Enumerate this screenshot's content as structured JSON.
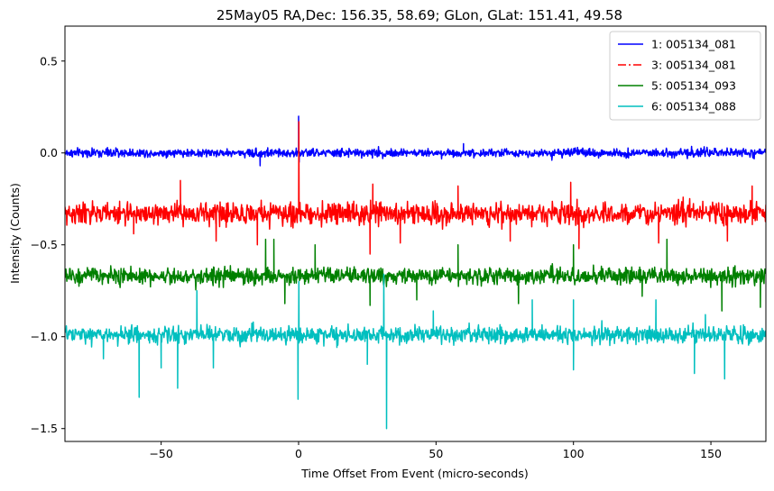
{
  "chart_data": {
    "type": "line",
    "title": "25May05 RA,Dec:  156.35,  58.69; GLon, GLat:  151.41,  49.58",
    "xlabel": "Time Offset From Event (micro-seconds)",
    "ylabel": "Intensity (Counts)",
    "xlim": [
      -85,
      170
    ],
    "ylim": [
      -1.57,
      0.69
    ],
    "xticks": [
      -50,
      0,
      50,
      100,
      150
    ],
    "xtick_labels": [
      "−50",
      "0",
      "50",
      "100",
      "150"
    ],
    "yticks": [
      0.5,
      0.0,
      -0.5,
      -1.0,
      -1.5
    ],
    "ytick_labels": [
      "0.5",
      "0.0",
      "−0.5",
      "−1.0",
      "−1.5"
    ],
    "grid": false,
    "legend_position": "top-right",
    "series": [
      {
        "name": "1: 005134_081",
        "color": "#0000ff",
        "linestyle": "solid",
        "baseline": 0.0,
        "noise": 0.018,
        "spikes": [
          [
            0.0,
            0.2
          ],
          [
            0.2,
            -0.05
          ],
          [
            -14,
            -0.07
          ],
          [
            60,
            0.05
          ]
        ]
      },
      {
        "name": "3: 005134_081",
        "color": "#ff0000",
        "linestyle": "dashdot",
        "baseline": -0.33,
        "noise": 0.045,
        "spikes": [
          [
            0.1,
            0.17
          ],
          [
            -60,
            -0.44
          ],
          [
            -43,
            -0.15
          ],
          [
            -30,
            -0.48
          ],
          [
            -15,
            -0.5
          ],
          [
            27,
            -0.17
          ],
          [
            26,
            -0.55
          ],
          [
            37,
            -0.49
          ],
          [
            58,
            -0.18
          ],
          [
            77,
            -0.48
          ],
          [
            99,
            -0.16
          ],
          [
            102,
            -0.52
          ],
          [
            131,
            -0.49
          ],
          [
            156,
            -0.48
          ],
          [
            165,
            -0.18
          ]
        ]
      },
      {
        "name": "5: 005134_093",
        "color": "#008000",
        "linestyle": "solid",
        "baseline": -0.67,
        "noise": 0.035,
        "spikes": [
          [
            -12,
            -0.47
          ],
          [
            -9,
            -0.47
          ],
          [
            -5,
            -0.82
          ],
          [
            6,
            -0.5
          ],
          [
            26,
            -0.83
          ],
          [
            43,
            -0.8
          ],
          [
            58,
            -0.5
          ],
          [
            80,
            -0.82
          ],
          [
            100,
            -0.5
          ],
          [
            125,
            -0.78
          ],
          [
            134,
            -0.47
          ],
          [
            154,
            -0.86
          ],
          [
            168,
            -0.84
          ]
        ]
      },
      {
        "name": "6: 005134_088",
        "color": "#00bfbf",
        "linestyle": "solid",
        "baseline": -0.99,
        "noise": 0.035,
        "spikes": [
          [
            -71,
            -1.12
          ],
          [
            -58,
            -1.33
          ],
          [
            -50,
            -1.17
          ],
          [
            -44,
            -1.28
          ],
          [
            -37,
            -0.75
          ],
          [
            -31,
            -1.17
          ],
          [
            -0.2,
            -1.34
          ],
          [
            0.1,
            -0.7
          ],
          [
            25,
            -1.15
          ],
          [
            32,
            -1.5
          ],
          [
            31,
            -0.66
          ],
          [
            49,
            -0.86
          ],
          [
            85,
            -0.8
          ],
          [
            100,
            -0.8
          ],
          [
            100,
            -1.18
          ],
          [
            130,
            -0.8
          ],
          [
            144,
            -1.2
          ],
          [
            148,
            -0.88
          ],
          [
            155,
            -1.23
          ]
        ]
      }
    ]
  }
}
